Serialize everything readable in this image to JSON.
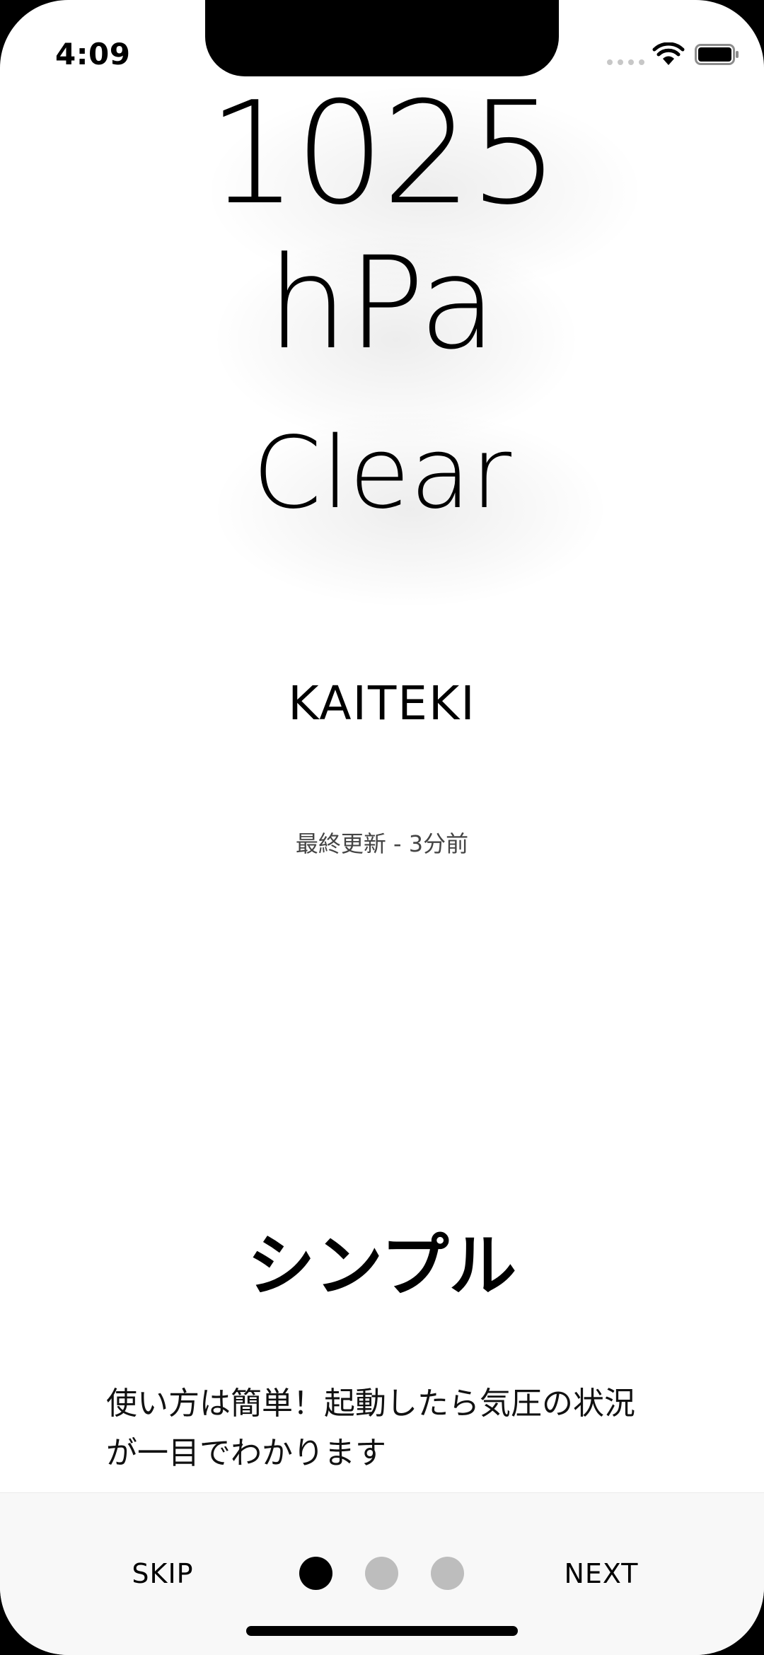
{
  "status_bar": {
    "time": "4:09",
    "signal_icon": "cellular-signal-icon",
    "wifi_icon": "wifi-icon",
    "battery_icon": "battery-icon"
  },
  "reading": {
    "pressure_value": "1025",
    "pressure_unit": "hPa",
    "weather": "Clear",
    "comfort_label": "KAITEKI",
    "last_updated": "最終更新 - 3分前"
  },
  "onboarding": {
    "title": "シンプル",
    "description": "使い方は簡単！起動したら気圧の状況が一目でわかります",
    "skip_label": "SKIP",
    "next_label": "NEXT",
    "page_count": 3,
    "current_page": 1
  },
  "colors": {
    "background": "#ffffff",
    "text": "#000000",
    "bottom_bar": "#f8f8f8",
    "dot_active": "#000000",
    "dot_inactive": "#bdbdbd"
  }
}
